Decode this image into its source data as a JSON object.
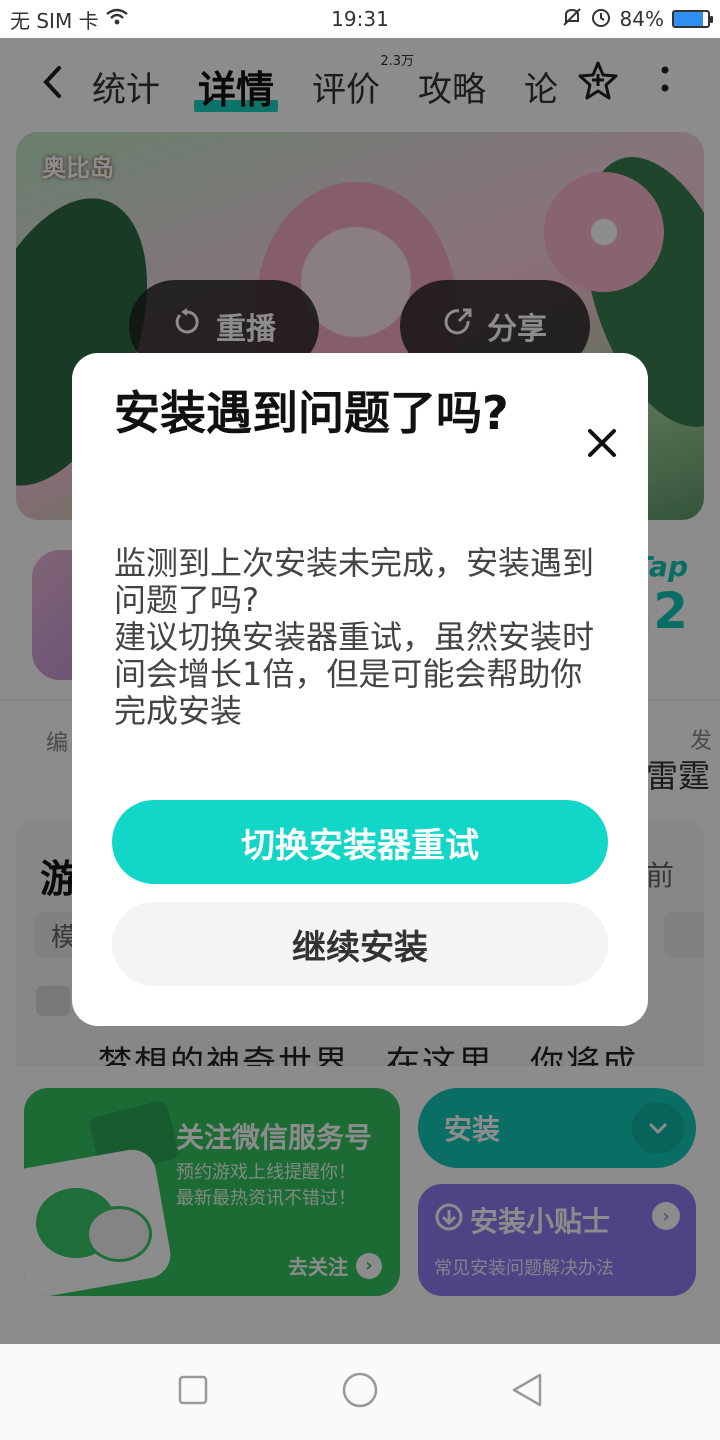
{
  "status_bar": {
    "carrier": "无 SIM 卡",
    "time": "19:31",
    "battery_text": "84%",
    "battery_level": 0.84
  },
  "nav": {
    "tabs": [
      {
        "label": "统计"
      },
      {
        "label": "详情"
      },
      {
        "label": "评价",
        "badge": "2.3万"
      },
      {
        "label": "攻略"
      },
      {
        "label": "论"
      }
    ]
  },
  "banner": {
    "logo_text": "奥比岛",
    "replay_label": "重播",
    "share_label": "分享"
  },
  "app_info": {
    "tap_label": "Tap",
    "score_partial": ".2"
  },
  "meta": {
    "left_partial": "编",
    "right_top_partial": "发",
    "right_partial": "雷霆"
  },
  "section": {
    "title_partial": "游",
    "right_partial": "前",
    "tag_partial": "模",
    "desc_partial": "梦想的神奇世界，在这里，你将成"
  },
  "bottom": {
    "wechat": {
      "title": "关注微信服务号",
      "line1": "预约游戏上线提醒你！",
      "line2": "最新最热资讯不错过！",
      "follow_label": "去关注"
    },
    "install_label": "安装",
    "tips": {
      "title": "安装小贴士",
      "subtitle": "常见安装问题解决办法"
    }
  },
  "dialog": {
    "title": "安装遇到问题了吗?",
    "message_line1": "监测到上次安装未完成，安装遇到问题了吗?",
    "message_line2": "建议切换安装器重试，虽然安装时间会增长1倍，但是可能会帮助你完成安装",
    "primary_button": "切换安装器重试",
    "secondary_button": "继续安装"
  },
  "colors": {
    "accent": "#12d6c8",
    "wechat_green": "#34c361",
    "tips_purple": "#8a7cf2"
  },
  "icons": [
    "wifi-icon",
    "mute-icon",
    "alarm-icon",
    "battery-icon",
    "back-arrow-icon",
    "star-icon",
    "more-icon",
    "replay-icon",
    "share-icon",
    "close-icon",
    "chevron-down-icon",
    "download-icon",
    "chevron-right-icon",
    "square-icon",
    "circle-icon",
    "triangle-back-icon"
  ]
}
